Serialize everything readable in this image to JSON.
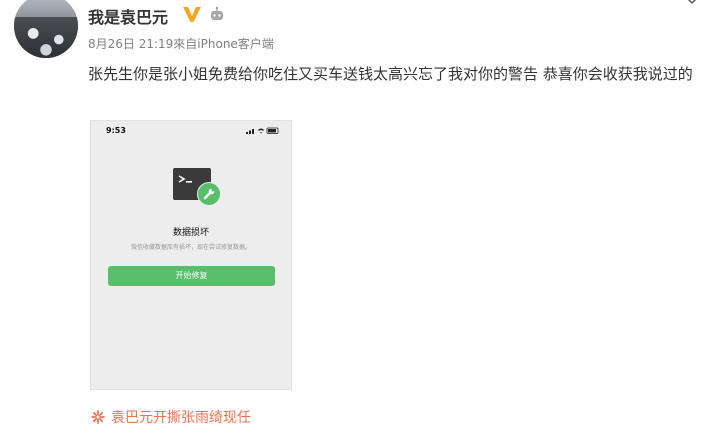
{
  "post": {
    "username": "我是袁巴元",
    "meta": "8月26日 21:19來自iPhone客户端",
    "text": "张先生你是张小姐免费给你吃住又买车送钱太高兴忘了我对你的警告 恭喜你会收获我说过的",
    "topic_link": "袁巴元开撕张雨绮现任"
  },
  "screenshot": {
    "status_time": "9:53",
    "title": "数据损坏",
    "subtitle": "微信收藏数据库有损坏，现在尝试修复数据。",
    "button_label": "开始修复"
  },
  "icons": {
    "verified": "verified-v-badge-icon",
    "robot": "robot-icon",
    "chevron": "chevron-down-icon",
    "topic": "topic-flower-icon",
    "terminal": "terminal-icon",
    "wrench": "wrench-icon"
  },
  "colors": {
    "accent_green": "#57be6a",
    "topic_orange": "#eb7350",
    "verified_gold": "#f5a623"
  }
}
